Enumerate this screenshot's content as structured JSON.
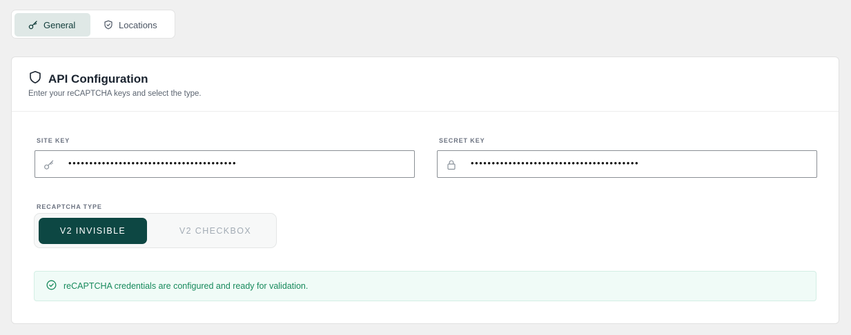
{
  "tabs": [
    {
      "label": "General",
      "icon": "key-icon",
      "active": true
    },
    {
      "label": "Locations",
      "icon": "shield-icon",
      "active": false
    }
  ],
  "card": {
    "title": "API Configuration",
    "title_icon": "shield-icon",
    "subtitle": "Enter your reCAPTCHA keys and select the type."
  },
  "fields": {
    "site_key": {
      "label": "SITE KEY",
      "value": "••••••••••••••••••••••••••••••••••••••••",
      "icon": "key-icon"
    },
    "secret_key": {
      "label": "SECRET KEY",
      "value": "••••••••••••••••••••••••••••••••••••••••",
      "icon": "lock-icon"
    }
  },
  "recaptcha_type": {
    "label": "RECAPTCHA TYPE",
    "options": [
      "V2 INVISIBLE",
      "V2 CHECKBOX"
    ],
    "selected": "V2 INVISIBLE"
  },
  "status": {
    "message": "reCAPTCHA credentials are configured and ready for validation.",
    "icon": "check-circle-icon"
  },
  "colors": {
    "accent": "#0d4743",
    "success": "#178a5c",
    "success_bg": "#f0fbf7"
  }
}
